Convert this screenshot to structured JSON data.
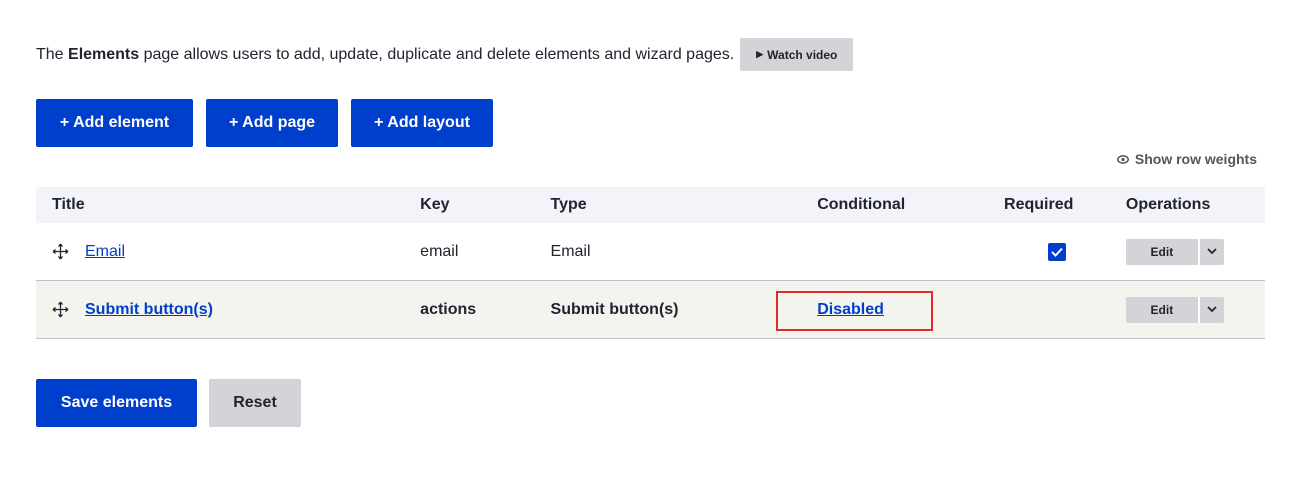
{
  "intro": {
    "prefix": "The ",
    "bold": "Elements",
    "suffix": " page allows users to add, update, duplicate and delete elements and wizard pages.",
    "watch_video": "Watch video"
  },
  "actions": {
    "add_element": "+ Add element",
    "add_page": "+ Add page",
    "add_layout": "+ Add layout"
  },
  "show_row_weights": "Show row weights",
  "table": {
    "headers": {
      "title": "Title",
      "key": "Key",
      "type": "Type",
      "conditional": "Conditional",
      "required": "Required",
      "operations": "Operations"
    },
    "rows": [
      {
        "title": "Email",
        "key": "email",
        "type": "Email",
        "conditional": "",
        "required": true,
        "edit": "Edit"
      },
      {
        "title": "Submit button(s)",
        "key": "actions",
        "type": "Submit button(s)",
        "conditional": "Disabled",
        "required": false,
        "edit": "Edit"
      }
    ]
  },
  "footer": {
    "save": "Save elements",
    "reset": "Reset"
  },
  "colors": {
    "primary": "#003ecc",
    "highlight": "#e0292b",
    "button_gray": "#d4d4d8"
  }
}
